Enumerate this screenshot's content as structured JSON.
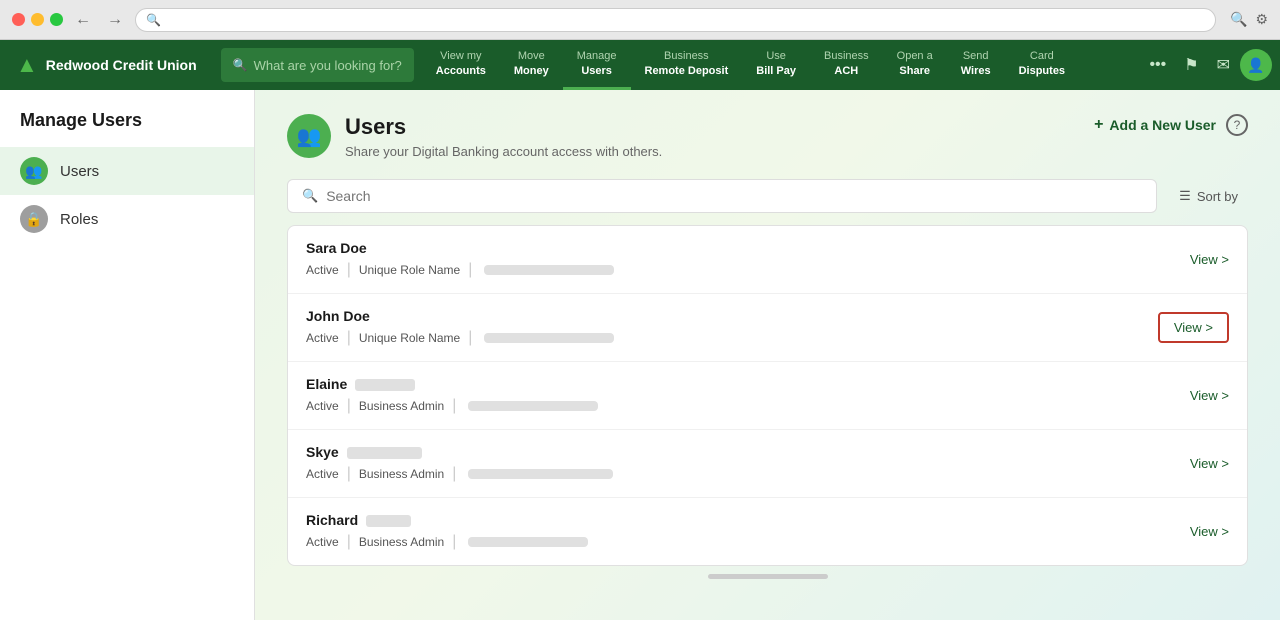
{
  "browser": {
    "url_placeholder": ""
  },
  "app": {
    "logo_text": "Redwood Credit Union",
    "search_placeholder": "What are you looking for?",
    "nav_links": [
      {
        "top": "View my",
        "bottom": "Accounts"
      },
      {
        "top": "Move",
        "bottom": "Money"
      },
      {
        "top": "Manage",
        "bottom": "Users",
        "active": true
      },
      {
        "top": "Business",
        "bottom": "Remote Deposit"
      },
      {
        "top": "Use",
        "bottom": "Bill Pay"
      },
      {
        "top": "Business",
        "bottom": "ACH"
      },
      {
        "top": "Open a",
        "bottom": "Share"
      },
      {
        "top": "Send",
        "bottom": "Wires"
      },
      {
        "top": "Card",
        "bottom": "Disputes"
      }
    ],
    "more_label": "•••"
  },
  "sidebar": {
    "title": "Manage Users",
    "items": [
      {
        "label": "Users",
        "icon_type": "green",
        "icon": "👥",
        "active": true
      },
      {
        "label": "Roles",
        "icon_type": "gray",
        "icon": "🔒",
        "active": false
      }
    ]
  },
  "content": {
    "page_icon": "👥",
    "title": "Users",
    "subtitle": "Share your Digital Banking account access with others.",
    "add_user_label": "Add a New User",
    "help_label": "?",
    "search_placeholder": "Search",
    "sort_label": "Sort by",
    "users": [
      {
        "name": "Sara Doe",
        "status": "Active",
        "role": "Unique Role Name",
        "view_label": "View >",
        "highlighted": false
      },
      {
        "name": "John Doe",
        "status": "Active",
        "role": "Unique Role Name",
        "view_label": "View >",
        "highlighted": true
      },
      {
        "name": "Elaine",
        "status": "Active",
        "role": "Business Admin",
        "view_label": "View >",
        "highlighted": false
      },
      {
        "name": "Skye",
        "status": "Active",
        "role": "Business Admin",
        "view_label": "View >",
        "highlighted": false
      },
      {
        "name": "Richard",
        "status": "Active",
        "role": "Business Admin",
        "view_label": "View >",
        "highlighted": false
      }
    ]
  }
}
